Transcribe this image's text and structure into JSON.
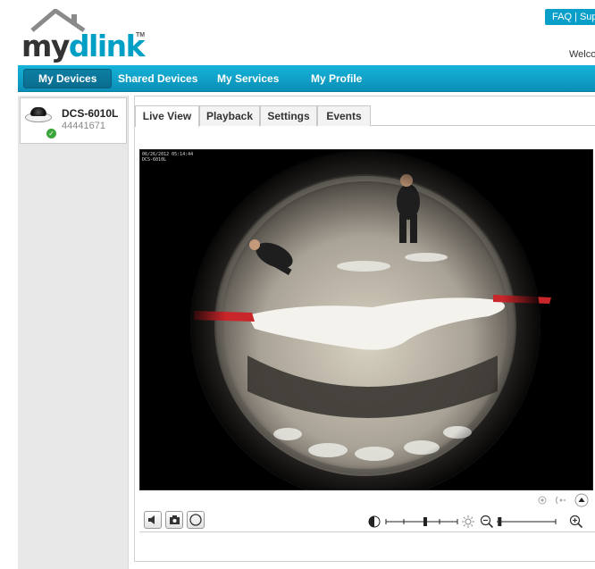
{
  "header": {
    "logo_text_my": "my",
    "logo_text_dlink": "dlink",
    "logo_tm": "TM",
    "faq_label": "FAQ | Sup",
    "welcome_text": "Welco"
  },
  "nav": {
    "items": [
      {
        "label": "My Devices",
        "active": true
      },
      {
        "label": "Shared Devices",
        "active": false
      },
      {
        "label": "My Services",
        "active": false
      },
      {
        "label": "My Profile",
        "active": false
      }
    ]
  },
  "sidebar": {
    "device": {
      "name": "DCS-6010L",
      "id": "44441671",
      "status": "online"
    }
  },
  "tabs": [
    {
      "label": "Live View",
      "active": true
    },
    {
      "label": "Playback",
      "active": false
    },
    {
      "label": "Settings",
      "active": false
    },
    {
      "label": "Events",
      "active": false
    }
  ],
  "video": {
    "timestamp": "06/26/2012 05:14:44",
    "camera_label": "DCS-6010L"
  },
  "controls": {
    "brightness_level": 0.55,
    "zoom_level": 0.05,
    "icons": [
      "speaker-icon",
      "snapshot-icon",
      "record-icon",
      "contrast-icon",
      "brightness-icon",
      "zoom-out-icon",
      "zoom-in-icon",
      "view-mode-icon",
      "ptz-icon",
      "up-arrow-icon"
    ]
  },
  "colors": {
    "brand_blue": "#00a0c6",
    "nav_blue": "#0a9fc9",
    "online_green": "#3aa53a"
  }
}
